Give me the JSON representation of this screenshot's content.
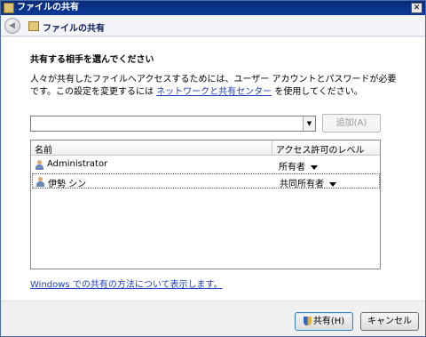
{
  "window": {
    "title": "ファイルの共有"
  },
  "nav": {
    "title": "ファイルの共有"
  },
  "content": {
    "heading": "共有する相手を選んでください",
    "description_1": "人々が共有したファイルへアクセスするためには、ユーザー アカウントとパスワードが必要です。この設定を変更するには ",
    "link_label": "ネットワークと共有センター",
    "description_2": " を使用してください。"
  },
  "name_input": {
    "value": ""
  },
  "add_button": {
    "label": "追加(A)"
  },
  "table": {
    "columns": [
      "名前",
      "アクセス許可のレベル"
    ],
    "rows": [
      {
        "name": "Administrator",
        "level": "所有者"
      },
      {
        "name": "伊勢 シン",
        "level": "共同所有者"
      }
    ]
  },
  "help_link": "Windows での共有の方法について表示します。",
  "footer": {
    "share_label": "共有(H)",
    "cancel_label": "キャンセル"
  }
}
